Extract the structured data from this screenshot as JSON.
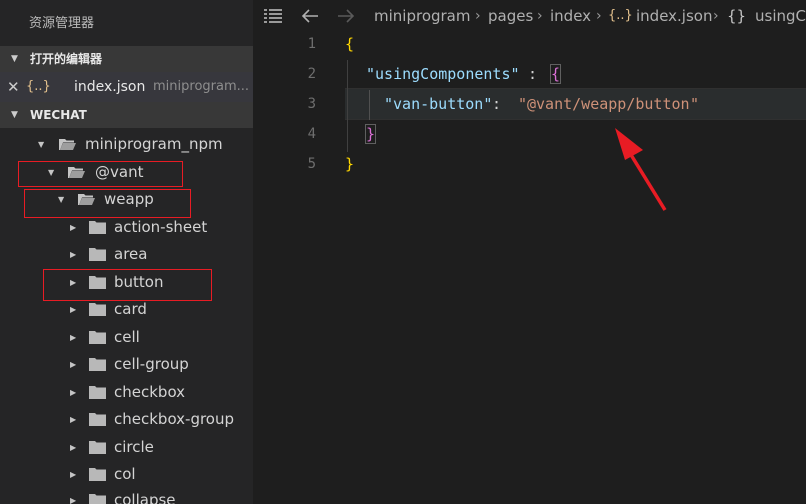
{
  "sidebar": {
    "title": "资源管理器",
    "open_editors": {
      "header": "打开的编辑器",
      "item": {
        "icon": "{..}",
        "name": "index.json",
        "path": "miniprogram..."
      }
    },
    "workspace": {
      "header": "WECHAT"
    },
    "tree": [
      {
        "label": "miniprogram_npm",
        "expanded": true,
        "depth": 0
      },
      {
        "label": "@vant",
        "expanded": true,
        "depth": 1
      },
      {
        "label": "weapp",
        "expanded": true,
        "depth": 2
      },
      {
        "label": "action-sheet",
        "expanded": false,
        "depth": 3
      },
      {
        "label": "area",
        "expanded": false,
        "depth": 3
      },
      {
        "label": "button",
        "expanded": false,
        "depth": 3
      },
      {
        "label": "card",
        "expanded": false,
        "depth": 3
      },
      {
        "label": "cell",
        "expanded": false,
        "depth": 3
      },
      {
        "label": "cell-group",
        "expanded": false,
        "depth": 3
      },
      {
        "label": "checkbox",
        "expanded": false,
        "depth": 3
      },
      {
        "label": "checkbox-group",
        "expanded": false,
        "depth": 3
      },
      {
        "label": "circle",
        "expanded": false,
        "depth": 3
      },
      {
        "label": "col",
        "expanded": false,
        "depth": 3
      },
      {
        "label": "collapse",
        "expanded": false,
        "depth": 3
      }
    ]
  },
  "breadcrumb": {
    "items": [
      "miniprogram",
      "pages",
      "index"
    ],
    "file_icon": "{..}",
    "file": "index.json",
    "symbol_icon": "{}",
    "symbol": "usingCo"
  },
  "editor": {
    "line_numbers": [
      "1",
      "2",
      "3",
      "4",
      "5"
    ],
    "code": {
      "open_brace": "{",
      "key1": "\"usingComponents\"",
      "colon": ": ",
      "open_brace2": "{",
      "key2": "\"van-button\"",
      "val_open_quote": "\"",
      "val": "@vant/weapp/button",
      "val_close_quote": "\"",
      "close_brace2": "}",
      "close_brace": "}"
    }
  },
  "colors": {
    "annotation": "#e81c24",
    "string": "#ce9178",
    "key": "#9cdcfe",
    "brace": "#ffd700",
    "brace2": "#da70d6"
  }
}
